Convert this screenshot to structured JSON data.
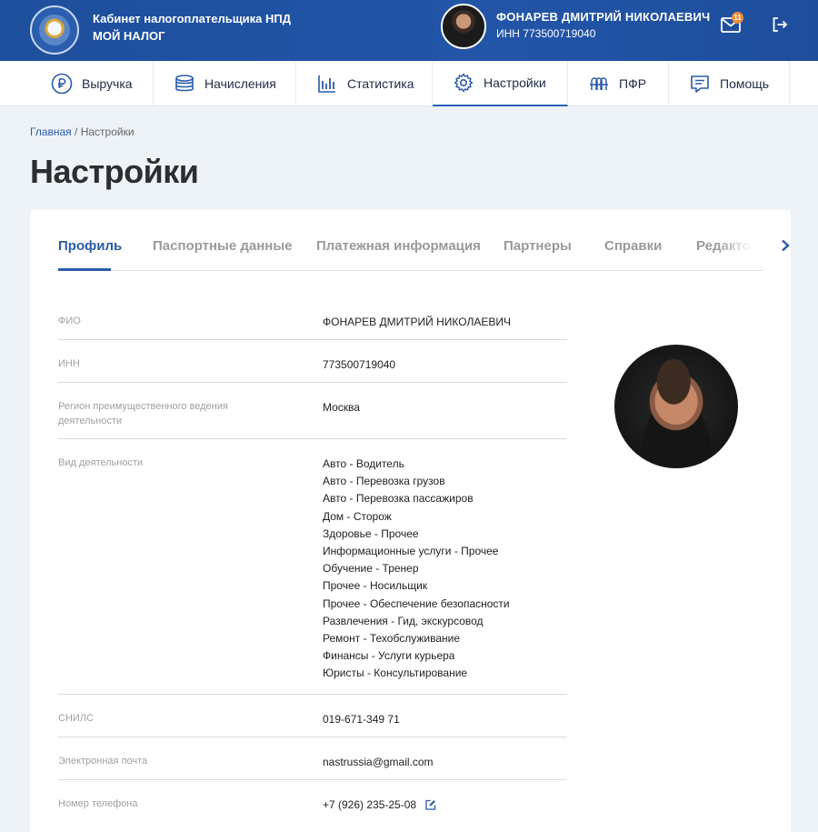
{
  "header": {
    "brand_line1": "Кабинет налогоплательщика НПД",
    "brand_line2": "МОЙ НАЛОГ",
    "user_name": "ФОНАРЕВ ДМИТРИЙ НИКОЛАЕВИЧ",
    "user_inn": "ИНН 773500719040",
    "notifications_count": "11"
  },
  "nav": {
    "items": [
      {
        "label": "Выручка",
        "icon": "ruble-icon"
      },
      {
        "label": "Начисления",
        "icon": "coins-icon"
      },
      {
        "label": "Статистика",
        "icon": "bar-chart-icon"
      },
      {
        "label": "Настройки",
        "icon": "gear-icon",
        "active": true
      },
      {
        "label": "ПФР",
        "icon": "pfr-icon"
      },
      {
        "label": "Помощь",
        "icon": "help-chat-icon"
      }
    ]
  },
  "breadcrumb": {
    "home": "Главная",
    "separator": " / ",
    "current": "Настройки"
  },
  "page_title": "Настройки",
  "tabs": [
    "Профиль",
    "Паспортные данные",
    "Платежная информация",
    "Партнеры",
    "Справки",
    "Редакто"
  ],
  "profile": {
    "fio_label": "ФИО",
    "fio": "ФОНАРЕВ ДМИТРИЙ НИКОЛАЕВИЧ",
    "inn_label": "ИНН",
    "inn": "773500719040",
    "region_label": "Регион преимущественного ведения деятельности",
    "region": "Москва",
    "activity_label": "Вид деятельности",
    "activities": [
      "Авто - Водитель",
      "Авто - Перевозка грузов",
      "Авто - Перевозка пассажиров",
      "Дом - Сторож",
      "Здоровье - Прочее",
      "Информационные услуги - Прочее",
      "Обучение - Тренер",
      "Прочее - Носильщик",
      "Прочее - Обеспечение безопасности",
      "Развлечения - Гид, экскурсовод",
      "Ремонт - Техобслуживание",
      "Финансы - Услуги курьера",
      "Юристы - Консультирование"
    ],
    "snils_label": "СНИЛС",
    "snils": "019-671-349 71",
    "email_label": "Электронная почта",
    "email": "nastrussia@gmail.com",
    "phone_label": "Номер телефона",
    "phone": "+7 (926) 235-25-08"
  },
  "colors": {
    "header_blue": "#2255a8",
    "accent": "#2a5ca8",
    "badge": "#f08c3a"
  }
}
